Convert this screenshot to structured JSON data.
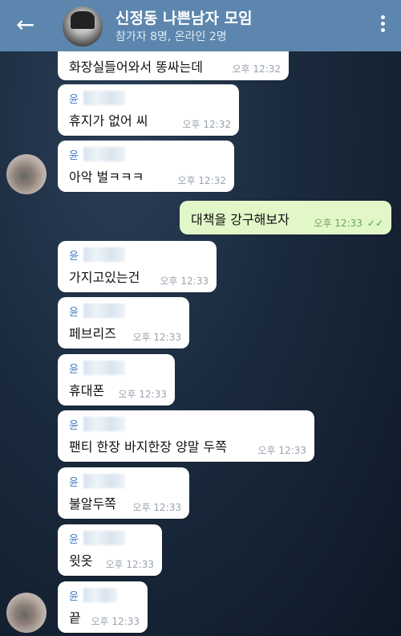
{
  "header": {
    "title": "신정동 나쁜남자 모임",
    "subtitle": "참가자 8명, 온라인 2명"
  },
  "messages": [
    {
      "sender": "",
      "text": "화장실들어와서 똥싸는데",
      "time": "오후 12:32"
    },
    {
      "sender": "윤",
      "text": "휴지가 없어 씨",
      "time": "오후 12:32"
    },
    {
      "sender": "윤",
      "text": "아악 벌ㅋㅋㅋ",
      "time": "오후 12:32"
    },
    {
      "sender": "",
      "text": "대책을 강구해보자",
      "time": "오후 12:33",
      "own": true
    },
    {
      "sender": "윤",
      "text": "가지고있는건",
      "time": "오후 12:33"
    },
    {
      "sender": "윤",
      "text": "페브리즈",
      "time": "오후 12:33"
    },
    {
      "sender": "윤",
      "text": "휴대폰",
      "time": "오후 12:33"
    },
    {
      "sender": "윤",
      "text": "팬티 한장 바지한장 양말 두쪽",
      "time": "오후 12:33"
    },
    {
      "sender": "윤",
      "text": "불알두쪽",
      "time": "오후 12:33"
    },
    {
      "sender": "윤",
      "text": "윗옷",
      "time": "오후 12:33"
    },
    {
      "sender": "윤",
      "text": "끝",
      "time": "오후 12:33"
    }
  ],
  "colors": {
    "header": "#5c86ad",
    "own_bubble": "#e2f7c8",
    "sender_name": "#3a7bbf"
  }
}
